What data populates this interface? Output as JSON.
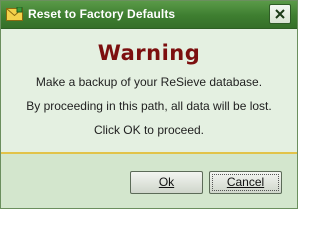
{
  "window": {
    "title": "Reset to Factory Defaults",
    "icon": "envelope-icon"
  },
  "message": {
    "heading": "Warning",
    "line1": "Make a backup of your ReSieve database.",
    "line2": "By proceeding in this path, all data will be lost.",
    "line3": "Click OK to proceed."
  },
  "buttons": {
    "ok_label": "Ok",
    "cancel_label": "Cancel"
  },
  "colors": {
    "titlebar": "#3e7e30",
    "heading": "#7c0f0f",
    "divider": "#e2c34a",
    "background": "#e4f0e1"
  }
}
